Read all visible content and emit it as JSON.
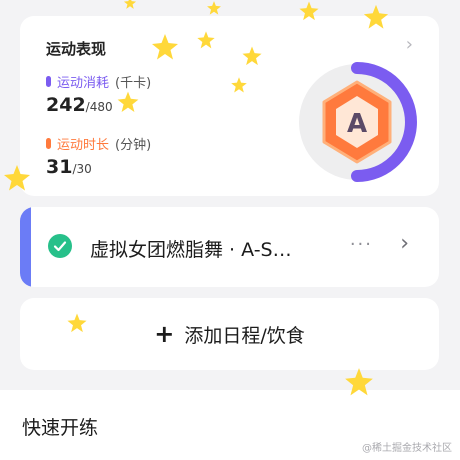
{
  "performance": {
    "title": "运动表现",
    "calories": {
      "label": "运动消耗",
      "unit": "(千卡)",
      "value": "242",
      "total": "/480",
      "color": "#7b5cf0"
    },
    "duration": {
      "label": "运动时长",
      "unit": "(分钟)",
      "value": "31",
      "total": "/30",
      "color": "#ff7a3d"
    },
    "grade": "A"
  },
  "schedule": {
    "title": "虚拟女团燃脂舞 · A-S…",
    "more": "···",
    "accent_color": "#6b7cf6",
    "check_color": "#27c08a"
  },
  "add": {
    "label": "添加日程/饮食"
  },
  "quick_start": {
    "title": "快速开练"
  },
  "watermark": "@稀土掘金技术社区",
  "icons": {
    "chevron": "chevron-right-icon",
    "check": "check-icon",
    "plus": "plus-icon",
    "star": "star-icon"
  }
}
